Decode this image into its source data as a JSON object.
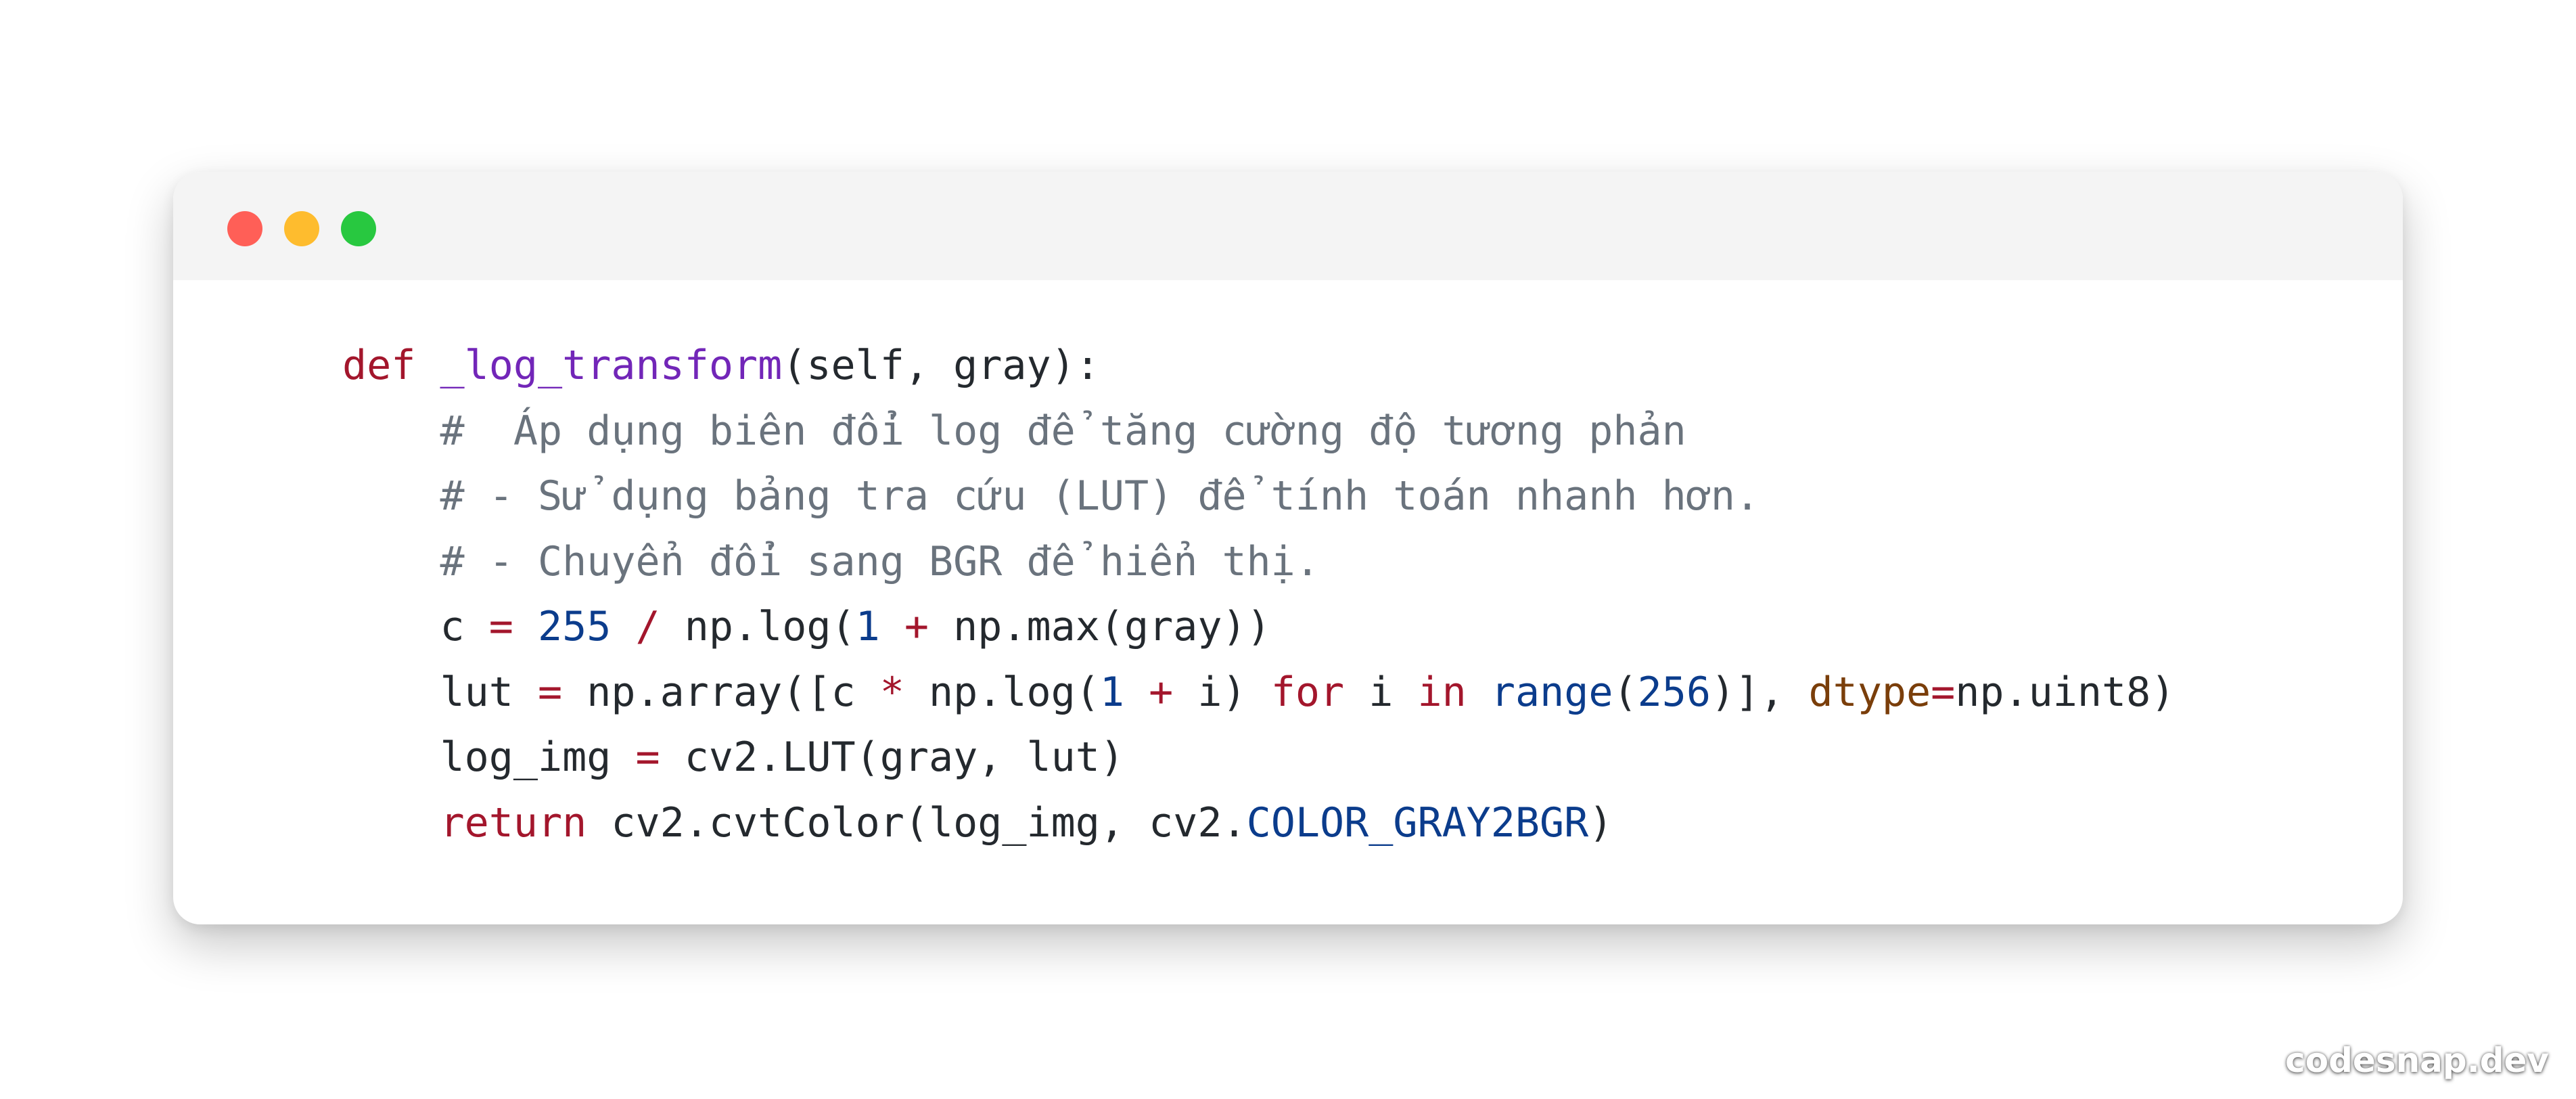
{
  "window": {
    "controls": [
      {
        "name": "close",
        "color": "#ff5f57"
      },
      {
        "name": "minimize",
        "color": "#febc2e"
      },
      {
        "name": "maximize",
        "color": "#28c840"
      }
    ]
  },
  "code": {
    "language": "python",
    "lines": [
      {
        "indent": "",
        "tokens": [
          {
            "t": "kw",
            "v": "def"
          },
          {
            "t": "pl",
            "v": " "
          },
          {
            "t": "fn",
            "v": "_log_transform"
          },
          {
            "t": "pl",
            "v": "(self, gray):"
          }
        ]
      },
      {
        "indent": "    ",
        "tokens": [
          {
            "t": "cm",
            "v": "#  Áp dụng biên đổi log để tăng cường độ tương phản"
          }
        ]
      },
      {
        "indent": "    ",
        "tokens": [
          {
            "t": "cm",
            "v": "# - Sử dụng bảng tra cứu (LUT) để tính toán nhanh hơn."
          }
        ]
      },
      {
        "indent": "    ",
        "tokens": [
          {
            "t": "cm",
            "v": "# - Chuyển đổi sang BGR để hiển thị."
          }
        ]
      },
      {
        "indent": "    ",
        "tokens": [
          {
            "t": "pl",
            "v": "c "
          },
          {
            "t": "op",
            "v": "="
          },
          {
            "t": "pl",
            "v": " "
          },
          {
            "t": "num",
            "v": "255"
          },
          {
            "t": "pl",
            "v": " "
          },
          {
            "t": "op",
            "v": "/"
          },
          {
            "t": "pl",
            "v": " np.log("
          },
          {
            "t": "num",
            "v": "1"
          },
          {
            "t": "pl",
            "v": " "
          },
          {
            "t": "op",
            "v": "+"
          },
          {
            "t": "pl",
            "v": " np.max(gray))"
          }
        ]
      },
      {
        "indent": "    ",
        "tokens": [
          {
            "t": "pl",
            "v": "lut "
          },
          {
            "t": "op",
            "v": "="
          },
          {
            "t": "pl",
            "v": " np.array([c "
          },
          {
            "t": "op",
            "v": "*"
          },
          {
            "t": "pl",
            "v": " np.log("
          },
          {
            "t": "num",
            "v": "1"
          },
          {
            "t": "pl",
            "v": " "
          },
          {
            "t": "op",
            "v": "+"
          },
          {
            "t": "pl",
            "v": " i) "
          },
          {
            "t": "kw",
            "v": "for"
          },
          {
            "t": "pl",
            "v": " i "
          },
          {
            "t": "kw",
            "v": "in"
          },
          {
            "t": "pl",
            "v": " "
          },
          {
            "t": "bi",
            "v": "range"
          },
          {
            "t": "pl",
            "v": "("
          },
          {
            "t": "num",
            "v": "256"
          },
          {
            "t": "pl",
            "v": ")], "
          },
          {
            "t": "param",
            "v": "dtype"
          },
          {
            "t": "op",
            "v": "="
          },
          {
            "t": "pl",
            "v": "np.uint8)"
          }
        ]
      },
      {
        "indent": "    ",
        "tokens": [
          {
            "t": "pl",
            "v": "log_img "
          },
          {
            "t": "op",
            "v": "="
          },
          {
            "t": "pl",
            "v": " cv2.LUT(gray, lut)"
          }
        ]
      },
      {
        "indent": "    ",
        "tokens": [
          {
            "t": "kw",
            "v": "return"
          },
          {
            "t": "pl",
            "v": " cv2.cvtColor(log_img, cv2."
          },
          {
            "t": "attr",
            "v": "COLOR_GRAY2BGR"
          },
          {
            "t": "pl",
            "v": ")"
          }
        ]
      }
    ]
  },
  "colors": {
    "keyword": "#a3162c",
    "function": "#7226b8",
    "comment": "#6a737d",
    "number": "#0b3c8c",
    "builtin": "#0b3c8c",
    "parameter": "#7a3e0a",
    "plain": "#24292e",
    "titlebar": "#f4f4f4"
  },
  "watermark": {
    "text": "codesnap.dev"
  }
}
